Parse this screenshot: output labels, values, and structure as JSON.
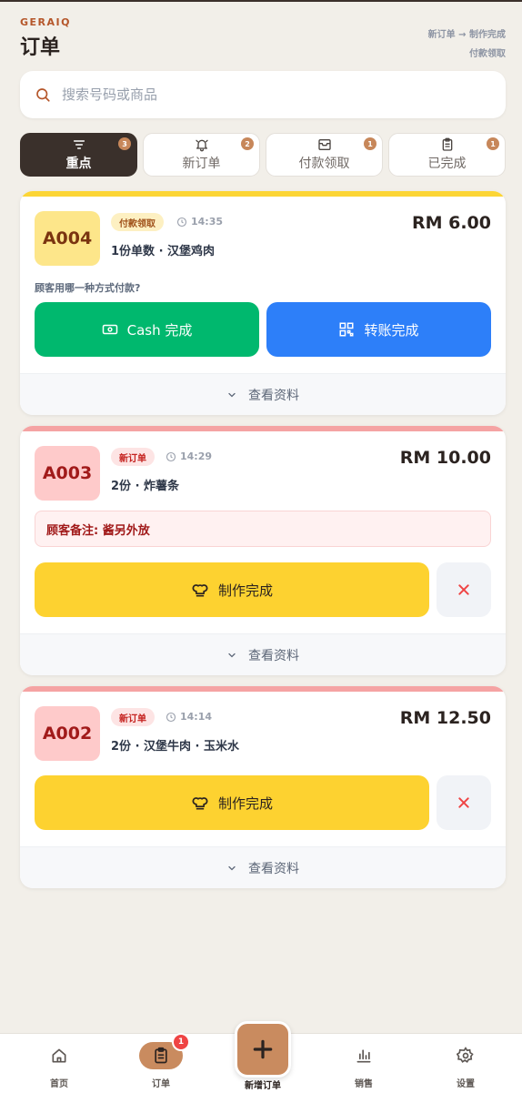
{
  "header": {
    "brand": "GERAIQ",
    "title": "订单",
    "flow_line1": "新订单 → 制作完成",
    "flow_line2": "付款领取"
  },
  "search": {
    "placeholder": "搜索号码或商品",
    "value": ""
  },
  "tabs": [
    {
      "label": "重点",
      "count": "3",
      "icon": "filter-icon",
      "active": true
    },
    {
      "label": "新订单",
      "count": "2",
      "icon": "bell-icon",
      "active": false
    },
    {
      "label": "付款领取",
      "count": "1",
      "icon": "inbox-icon",
      "active": false
    },
    {
      "label": "已完成",
      "count": "1",
      "icon": "clipboard-icon",
      "active": false
    }
  ],
  "orders": [
    {
      "code": "A004",
      "status": "付款领取",
      "time": "14:35",
      "items": "1份单数 · 汉堡鸡肉",
      "price": "RM 6.00",
      "question": "顾客用哪一种方式付款?",
      "cash_label": "Cash 完成",
      "transfer_label": "转账完成",
      "details_label": "查看资料",
      "strip_color": "#fcd535"
    },
    {
      "code": "A003",
      "status": "新订单",
      "time": "14:29",
      "items": "2份 · 炸薯条",
      "price": "RM 10.00",
      "note": "顾客备注: 酱另外放",
      "done_label": "制作完成",
      "details_label": "查看资料",
      "strip_color": "#f5a3a3"
    },
    {
      "code": "A002",
      "status": "新订单",
      "time": "14:14",
      "items": "2份 · 汉堡牛肉 · 玉米水",
      "price": "RM 12.50",
      "done_label": "制作完成",
      "details_label": "查看资料",
      "strip_color": "#f5a3a3"
    }
  ],
  "bottom_nav": {
    "home": "首页",
    "orders": "订单",
    "orders_badge": "1",
    "new_order": "新增订单",
    "sales": "销售",
    "settings": "设置"
  },
  "colors": {
    "accent": "#c98b5f",
    "active_tab": "#3a302b",
    "cash_green": "#00b86e",
    "transfer_blue": "#2d7ff9",
    "done_yellow": "#fdd230",
    "cancel_red": "#ef4444"
  }
}
